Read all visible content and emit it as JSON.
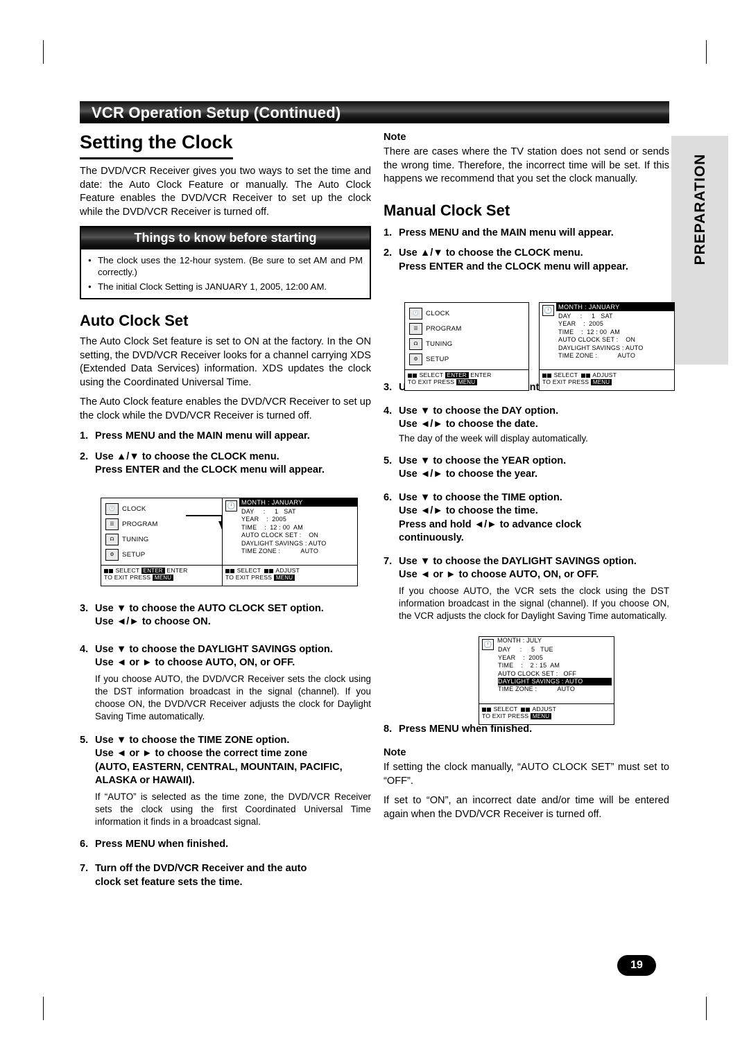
{
  "header": {
    "title": "VCR Operation Setup (Continued)"
  },
  "side_tab": {
    "label": "PREPARATION"
  },
  "page_number": "19",
  "left": {
    "heading": "Setting the Clock",
    "intro": "The DVD/VCR Receiver gives you two ways to set the time and date: the Auto Clock Feature or manually. The Auto Clock Feature enables the DVD/VCR Receiver to set up the clock while the DVD/VCR Receiver is turned off.",
    "things_box": {
      "title": "Things to know before starting",
      "items": [
        "The clock uses the 12-hour system. (Be sure to set AM and PM correctly.)",
        "The initial Clock Setting is JANUARY 1, 2005, 12:00 AM."
      ]
    },
    "auto_heading": "Auto Clock Set",
    "auto_p1": "The Auto Clock Set feature is set to ON at the factory. In the ON setting, the DVD/VCR Receiver looks for a channel carrying XDS (Extended Data Services) information. XDS updates the clock using the Coordinated Universal Time.",
    "auto_p2": "The Auto Clock feature enables the DVD/VCR Receiver to set up the clock while the DVD/VCR Receiver is turned off.",
    "steps": [
      {
        "n": "1.",
        "t": "Press MENU and the MAIN menu will appear."
      },
      {
        "n": "2.",
        "t": "Use ▲/▼ to choose the CLOCK menu.",
        "t2": "Press ENTER and the CLOCK menu will appear."
      },
      {
        "n": "3.",
        "t": "Use ▼ to choose the AUTO CLOCK SET option.",
        "t2": "Use ◄/► to choose ON."
      },
      {
        "n": "4.",
        "t": "Use ▼ to choose the DAYLIGHT SAVINGS option.",
        "t2": "Use ◄ or ► to choose AUTO, ON, or OFF.",
        "p": "If you choose AUTO, the DVD/VCR Receiver sets the clock using the DST information broadcast in the signal (channel). If you choose ON, the DVD/VCR Receiver adjusts the clock for Daylight Saving Time automatically."
      },
      {
        "n": "5.",
        "t": "Use ▼ to choose the TIME ZONE option.",
        "t2": "Use ◄ or ► to choose the correct time zone",
        "t3": "(AUTO, EASTERN, CENTRAL, MOUNTAIN, PACIFIC, ALASKA or HAWAII).",
        "p": "If “AUTO” is selected as the time zone, the DVD/VCR Receiver sets the clock using the first Coordinated Universal Time information it finds in a broadcast signal."
      },
      {
        "n": "6.",
        "t": "Press MENU when finished."
      },
      {
        "n": "7.",
        "t": "Turn off the DVD/VCR Receiver and the auto",
        "t2": "clock set feature sets the time."
      }
    ]
  },
  "right": {
    "note_label": "Note",
    "note_text": "There are cases where the TV station does not send or sends the wrong time. Therefore, the incorrect time will be set. If this happens we recommend that you set the clock manually.",
    "manual_heading": "Manual Clock Set",
    "steps": [
      {
        "n": "1.",
        "t": "Press MENU and the MAIN menu will appear."
      },
      {
        "n": "2.",
        "t": "Use ▲/▼ to choose the CLOCK menu.",
        "t2": "Press ENTER and the CLOCK menu will appear."
      },
      {
        "n": "3.",
        "t": "Use ◄/► to choose the month."
      },
      {
        "n": "4.",
        "t": "Use ▼ to choose the DAY option.",
        "t2": "Use ◄/► to choose the date.",
        "p": "The day of the week will display automatically."
      },
      {
        "n": "5.",
        "t": "Use ▼ to choose the YEAR option.",
        "t2": "Use ◄/► to choose the year."
      },
      {
        "n": "6.",
        "t": "Use ▼ to choose the TIME option.",
        "t2": "Use ◄/► to choose the time.",
        "t3": "Press and hold ◄/► to advance clock",
        "t4": "continuously."
      },
      {
        "n": "7.",
        "t": "Use ▼ to choose the DAYLIGHT SAVINGS option.",
        "t2": "Use ◄ or ► to choose AUTO, ON, or OFF.",
        "p": "If you choose AUTO, the VCR sets the clock using the DST information broadcast in the signal (channel). If you choose ON, the VCR adjusts the clock for Daylight Saving Time automatically."
      },
      {
        "n": "8.",
        "t": "Press MENU when finished."
      }
    ],
    "note2_label": "Note",
    "note2_p1": "If setting the clock manually, “AUTO CLOCK SET” must set to “OFF”.",
    "note2_p2": "If set to “ON”, an incorrect date and/or time will be entered again when the DVD/VCR Receiver is turned off."
  },
  "osd": {
    "main_menu": {
      "items": [
        "CLOCK",
        "PROGRAM",
        "TUNING",
        "SETUP"
      ],
      "icons": [
        "clock-icon",
        "program-icon",
        "tuning-icon",
        "setup-icon"
      ],
      "footer_line1_pre": "SELECT",
      "footer_line1_key": "ENTER",
      "footer_line1_post": "ENTER",
      "footer_line2_pre": "TO EXIT PRESS",
      "footer_line2_key": "MENU"
    },
    "clock_menu_1": {
      "title": "MONTH : JANUARY",
      "rows": [
        "DAY     :     1   SAT",
        "YEAR    :  2005",
        "TIME    :  12 : 00  AM",
        "AUTO CLOCK SET :    ON",
        "DAYLIGHT SAVINGS : AUTO",
        "TIME ZONE :           AUTO"
      ],
      "highlight_index": -1,
      "footer_line1_a": "SELECT",
      "footer_line1_b": "ADJUST",
      "footer_line2_pre": "TO EXIT PRESS",
      "footer_line2_key": "MENU"
    },
    "clock_menu_2": {
      "title": "MONTH : JANUARY",
      "rows": [
        "DAY     :     1   SAT",
        "YEAR    :  2005",
        "TIME    :  12 : 00  AM",
        "AUTO CLOCK SET :    ON",
        "DAYLIGHT SAVINGS : AUTO",
        "TIME ZONE :           AUTO"
      ],
      "highlight_index": -1,
      "footer_line1_a": "SELECT",
      "footer_line1_b": "ADJUST",
      "footer_line2_pre": "TO EXIT PRESS",
      "footer_line2_key": "MENU"
    },
    "clock_menu_3": {
      "title": "MONTH : JULY",
      "rows": [
        "DAY     :     5   TUE",
        "YEAR    :  2005",
        "TIME    :    2 : 15  AM",
        "AUTO CLOCK SET :   OFF",
        "DAYLIGHT SAVINGS : AUTO",
        "TIME ZONE :           AUTO"
      ],
      "highlight_index": 4,
      "footer_line1_a": "SELECT",
      "footer_line1_b": "ADJUST",
      "footer_line2_pre": "TO EXIT PRESS",
      "footer_line2_key": "MENU"
    }
  }
}
